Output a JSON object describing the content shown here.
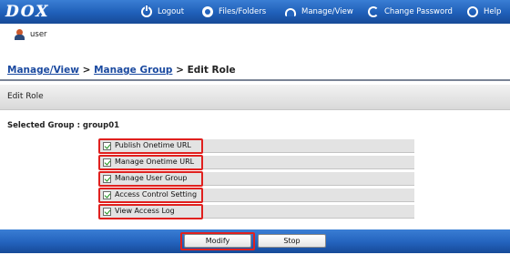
{
  "app": {
    "logo": "DOX"
  },
  "nav": [
    {
      "label": "Logout",
      "icon": "logout-icon"
    },
    {
      "label": "Files/Folders",
      "icon": "files-folders-icon"
    },
    {
      "label": "Manage/View",
      "icon": "manage-view-icon"
    },
    {
      "label": "Change Password",
      "icon": "change-password-icon"
    },
    {
      "label": "Help",
      "icon": "help-icon"
    }
  ],
  "user": {
    "name": "user",
    "icon": "user-avatar-icon"
  },
  "breadcrumb": {
    "items": [
      "Manage/View",
      "Manage Group"
    ],
    "separator": ">",
    "current": "Edit Role"
  },
  "page": {
    "title": "Edit Role",
    "selected_group_label": "Selected Group : group01"
  },
  "roles": [
    {
      "label": "Publish Onetime URL",
      "checked": true
    },
    {
      "label": "Manage Onetime URL",
      "checked": true
    },
    {
      "label": "Manage User Group",
      "checked": true
    },
    {
      "label": "Access Control Setting",
      "checked": true
    },
    {
      "label": "View Access Log",
      "checked": true
    }
  ],
  "actions": {
    "modify_label": "Modify",
    "stop_label": "Stop"
  },
  "colors": {
    "bar_blue": "#2464bd",
    "highlight_red": "#e0201e",
    "check_green": "#1a8f1a"
  }
}
